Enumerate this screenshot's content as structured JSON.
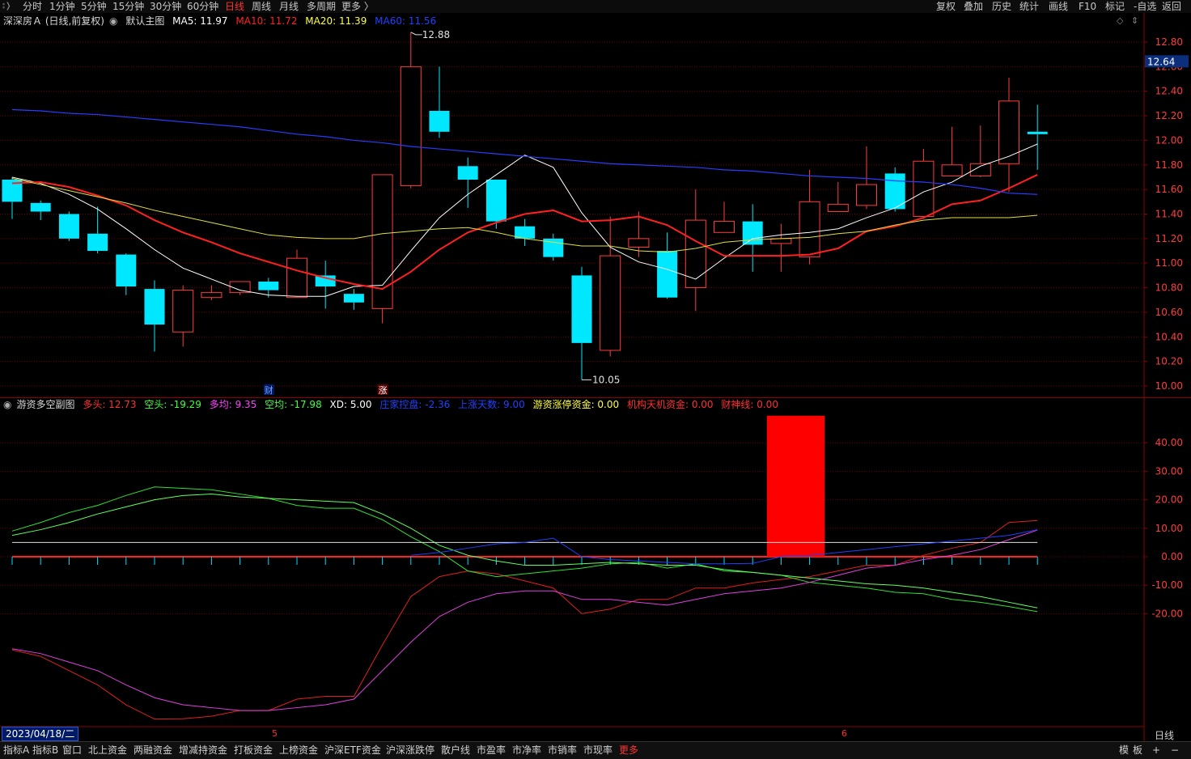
{
  "top_nav": {
    "left": [
      "分时",
      "1分钟",
      "5分钟",
      "15分钟",
      "30分钟",
      "60分钟",
      "日线",
      "周线",
      "月线",
      "多周期",
      "更多 〉"
    ],
    "active": "日线",
    "right": [
      "复权",
      "叠加",
      "历史",
      "统计",
      "画线",
      "F10",
      "标记",
      "-自选",
      "返回"
    ]
  },
  "main_legend": {
    "title": "深深房Ａ (日线,前复权)",
    "indicator_name": "默认主图",
    "items": [
      {
        "label": "MA5: 11.97",
        "color": "#ffffff"
      },
      {
        "label": "MA10: 11.72",
        "color": "#ff2020"
      },
      {
        "label": "MA20: 11.39",
        "color": "#ffff40"
      },
      {
        "label": "MA60: 11.56",
        "color": "#2040ff"
      }
    ]
  },
  "sub_legend": {
    "indicator_name": "游资多空副图",
    "items": [
      {
        "label": "多头: 12.73",
        "color": "#ff3030"
      },
      {
        "label": "空头: -19.29",
        "color": "#40ff40"
      },
      {
        "label": "多均: 9.35",
        "color": "#ff40ff"
      },
      {
        "label": "空均: -17.98",
        "color": "#40ff40"
      },
      {
        "label": "XD: 5.00",
        "color": "#ffffff"
      },
      {
        "label": "庄家控盘: -2.36",
        "color": "#2040ff"
      },
      {
        "label": "上涨天数: 9.00",
        "color": "#2040ff"
      },
      {
        "label": "游资涨停资金: 0.00",
        "color": "#ffff40"
      },
      {
        "label": "机构天机资金: 0.00",
        "color": "#ff3030"
      },
      {
        "label": "财神线: 0.00",
        "color": "#ff3030"
      }
    ]
  },
  "price_axis": {
    "ticks": [
      "12.80",
      "12.60",
      "12.40",
      "12.20",
      "12.00",
      "11.80",
      "11.60",
      "11.40",
      "11.20",
      "11.00",
      "10.80",
      "10.60",
      "10.40",
      "10.20",
      "10.00"
    ],
    "current_price": "12.64"
  },
  "annotations": {
    "high": "12.88",
    "low": "10.05",
    "marker_cai": "财",
    "marker_zhang": "涨"
  },
  "sub_axis": {
    "ticks": [
      "40.00",
      "30.00",
      "20.00",
      "10.00",
      "0.00",
      "-10.00",
      "-20.00"
    ]
  },
  "colors": {
    "up": "#ff3c3c",
    "down": "#00e8ff",
    "grid": "#6b0000"
  },
  "chart_data": [
    {
      "type": "candlestick",
      "title": "深深房Ａ (日线,前复权)",
      "ylim": [
        10.0,
        12.9
      ],
      "candles": [
        {
          "o": 11.68,
          "c": 11.5,
          "h": 11.7,
          "l": 11.36
        },
        {
          "o": 11.49,
          "c": 11.42,
          "h": 11.51,
          "l": 11.35
        },
        {
          "o": 11.4,
          "c": 11.2,
          "h": 11.42,
          "l": 11.18
        },
        {
          "o": 11.24,
          "c": 11.1,
          "h": 11.46,
          "l": 11.08
        },
        {
          "o": 11.07,
          "c": 10.81,
          "h": 11.08,
          "l": 10.74
        },
        {
          "o": 10.79,
          "c": 10.5,
          "h": 10.86,
          "l": 10.28
        },
        {
          "o": 10.44,
          "c": 10.78,
          "h": 10.82,
          "l": 10.32
        },
        {
          "o": 10.72,
          "c": 10.76,
          "h": 10.82,
          "l": 10.7
        },
        {
          "o": 10.76,
          "c": 10.85,
          "h": 10.85,
          "l": 10.74
        },
        {
          "o": 10.85,
          "c": 10.78,
          "h": 10.88,
          "l": 10.72
        },
        {
          "o": 10.72,
          "c": 11.04,
          "h": 11.11,
          "l": 10.72
        },
        {
          "o": 10.9,
          "c": 10.81,
          "h": 11.02,
          "l": 10.63
        },
        {
          "o": 10.75,
          "c": 10.68,
          "h": 10.79,
          "l": 10.62
        },
        {
          "o": 10.63,
          "c": 11.72,
          "h": 11.72,
          "l": 10.51
        },
        {
          "o": 11.63,
          "c": 12.6,
          "h": 12.88,
          "l": 11.61
        },
        {
          "o": 12.24,
          "c": 12.07,
          "h": 12.6,
          "l": 12.02
        },
        {
          "o": 11.79,
          "c": 11.68,
          "h": 11.86,
          "l": 11.45
        },
        {
          "o": 11.68,
          "c": 11.34,
          "h": 11.67,
          "l": 11.28
        },
        {
          "o": 11.3,
          "c": 11.2,
          "h": 11.36,
          "l": 11.14
        },
        {
          "o": 11.2,
          "c": 11.05,
          "h": 11.24,
          "l": 11.02
        },
        {
          "o": 10.9,
          "c": 10.35,
          "h": 10.97,
          "l": 10.05
        },
        {
          "o": 10.29,
          "c": 11.06,
          "h": 11.38,
          "l": 10.24
        },
        {
          "o": 11.13,
          "c": 11.2,
          "h": 11.42,
          "l": 11.05
        },
        {
          "o": 11.1,
          "c": 10.72,
          "h": 11.25,
          "l": 10.71
        },
        {
          "o": 10.8,
          "c": 11.35,
          "h": 11.6,
          "l": 10.61
        },
        {
          "o": 11.25,
          "c": 11.34,
          "h": 11.5,
          "l": 11.25
        },
        {
          "o": 11.34,
          "c": 11.15,
          "h": 11.48,
          "l": 10.93
        },
        {
          "o": 11.16,
          "c": 11.2,
          "h": 11.32,
          "l": 10.93
        },
        {
          "o": 11.05,
          "c": 11.5,
          "h": 11.76,
          "l": 10.99
        },
        {
          "o": 11.42,
          "c": 11.48,
          "h": 11.66,
          "l": 11.42
        },
        {
          "o": 11.47,
          "c": 11.64,
          "h": 11.95,
          "l": 11.44
        },
        {
          "o": 11.73,
          "c": 11.44,
          "h": 11.78,
          "l": 11.42
        },
        {
          "o": 11.38,
          "c": 11.83,
          "h": 11.93,
          "l": 11.36
        },
        {
          "o": 11.71,
          "c": 11.8,
          "h": 12.11,
          "l": 11.71
        },
        {
          "o": 11.71,
          "c": 11.81,
          "h": 12.12,
          "l": 11.7
        },
        {
          "o": 11.81,
          "c": 12.32,
          "h": 12.51,
          "l": 11.58
        },
        {
          "o": 12.07,
          "c": 12.05,
          "h": 12.29,
          "l": 11.76
        }
      ],
      "series": [
        {
          "name": "MA5",
          "values": [
            11.7,
            11.65,
            11.56,
            11.44,
            11.28,
            11.11,
            10.96,
            10.87,
            10.78,
            10.74,
            10.73,
            10.73,
            10.81,
            10.82,
            11.1,
            11.37,
            11.56,
            11.72,
            11.88,
            11.78,
            11.41,
            11.13,
            11.01,
            10.95,
            10.87,
            11.04,
            11.2,
            11.23,
            11.25,
            11.28,
            11.37,
            11.45,
            11.58,
            11.66,
            11.79,
            11.87,
            11.97
          ]
        },
        {
          "name": "MA10",
          "values": [
            11.65,
            11.66,
            11.62,
            11.55,
            11.47,
            11.35,
            11.25,
            11.17,
            11.08,
            11.01,
            10.94,
            10.88,
            10.83,
            10.79,
            10.93,
            11.11,
            11.25,
            11.33,
            11.4,
            11.43,
            11.34,
            11.35,
            11.38,
            11.31,
            11.18,
            11.06,
            11.06,
            11.06,
            11.07,
            11.12,
            11.26,
            11.3,
            11.37,
            11.48,
            11.51,
            11.61,
            11.72
          ]
        },
        {
          "name": "MA20",
          "values": [
            11.69,
            11.64,
            11.59,
            11.54,
            11.49,
            11.43,
            11.38,
            11.33,
            11.28,
            11.23,
            11.21,
            11.2,
            11.2,
            11.24,
            11.26,
            11.28,
            11.29,
            11.25,
            11.2,
            11.17,
            11.14,
            11.14,
            11.1,
            11.09,
            11.12,
            11.17,
            11.19,
            11.2,
            11.21,
            11.24,
            11.26,
            11.31,
            11.35,
            11.37,
            11.37,
            11.37,
            11.39
          ]
        },
        {
          "name": "MA60",
          "values": [
            12.25,
            12.24,
            12.22,
            12.21,
            12.19,
            12.17,
            12.15,
            12.13,
            12.11,
            12.08,
            12.05,
            12.03,
            12.0,
            11.98,
            11.95,
            11.93,
            11.91,
            11.89,
            11.87,
            11.85,
            11.83,
            11.81,
            11.8,
            11.79,
            11.78,
            11.76,
            11.75,
            11.73,
            11.71,
            11.7,
            11.69,
            11.67,
            11.66,
            11.64,
            11.61,
            11.57,
            11.56
          ]
        }
      ]
    },
    {
      "type": "line",
      "title": "游资多空副图",
      "ylim": [
        -55,
        50
      ],
      "series": [
        {
          "name": "多头",
          "values": [
            -32.7,
            -35,
            -40,
            -45,
            -52,
            -57,
            -56.9,
            -56,
            -54,
            -54,
            -50,
            -49,
            -49,
            -31,
            -14,
            -7,
            -5,
            -6,
            -8.5,
            -11,
            -20,
            -18.4,
            -15,
            -15,
            -11,
            -11,
            -9.2,
            -8,
            -7,
            -5,
            -3,
            -3,
            0.5,
            3,
            5,
            12,
            12.73
          ]
        },
        {
          "name": "空头",
          "values": [
            9,
            12,
            15.5,
            18,
            21.5,
            24.5,
            24,
            23.5,
            22,
            20.5,
            18,
            17,
            17,
            13,
            7,
            1.8,
            -5,
            -7,
            -6,
            -5,
            -4,
            -2.5,
            -2,
            -4,
            -2.5,
            -5,
            -5.5,
            -6.5,
            -9,
            -10,
            -11,
            -12.5,
            -13,
            -15,
            -16,
            -17.5,
            -19.29
          ]
        },
        {
          "name": "多均",
          "values": [
            -32.3,
            -34,
            -37,
            -40,
            -45,
            -49.5,
            -52,
            -53,
            -54,
            -54,
            -53,
            -52,
            -50,
            -40,
            -30,
            -21,
            -16,
            -13,
            -12,
            -12,
            -15,
            -15,
            -16,
            -17,
            -15,
            -13,
            -12,
            -11,
            -9,
            -6.5,
            -4,
            -3,
            -1,
            0.5,
            2.5,
            6,
            9.35
          ]
        },
        {
          "name": "空均",
          "values": [
            7.5,
            9.5,
            12,
            15,
            17.5,
            20,
            21.5,
            22,
            21,
            20.5,
            20,
            19.5,
            19,
            15,
            10,
            4,
            0.5,
            -1.5,
            -3,
            -3,
            -2.5,
            -2,
            -2.5,
            -3,
            -3,
            -4.5,
            -5.5,
            -6.5,
            -7.5,
            -8.5,
            -9.5,
            -10,
            -11,
            -12.5,
            -14,
            -16,
            -17.98
          ]
        },
        {
          "name": "XD",
          "values": [
            5,
            5,
            5,
            5,
            5,
            5,
            5,
            5,
            5,
            5,
            5,
            5,
            5,
            5,
            5,
            5,
            5,
            5,
            5,
            5,
            5,
            5,
            5,
            5,
            5,
            5,
            5,
            5,
            5,
            5,
            5,
            5,
            5,
            5,
            5,
            5,
            5
          ]
        },
        {
          "name": "庄家控盘",
          "values": [
            null,
            null,
            null,
            null,
            null,
            null,
            null,
            null,
            null,
            null,
            null,
            null,
            null,
            null,
            0.5,
            1.5,
            3,
            4.5,
            5,
            6.5,
            0,
            -1,
            -1.5,
            -2,
            -2.5,
            -2.5,
            -2.36,
            0,
            0.5,
            1.5,
            2.5,
            3.5,
            4.5,
            5.5,
            6.5,
            7.5,
            9.5
          ]
        },
        {
          "name": "游资涨停资金",
          "bar_values": [
            0,
            0,
            0,
            0,
            0,
            0,
            0,
            0,
            0,
            0,
            0,
            0,
            0,
            0,
            0,
            0,
            0,
            0,
            0,
            0,
            0,
            0,
            0,
            0,
            0,
            0,
            0,
            0,
            0,
            0,
            0,
            0,
            0,
            0,
            0,
            0,
            0
          ]
        },
        {
          "name": "机构天机资金",
          "values": [
            0
          ]
        },
        {
          "name": "财神线",
          "bar_values": [
            0,
            0,
            0,
            0,
            0,
            0,
            0,
            0,
            0,
            0,
            0,
            0,
            0,
            0,
            0,
            0,
            0,
            0,
            0,
            0,
            0,
            0,
            0,
            0,
            0,
            0,
            0,
            49.5,
            49.5,
            0,
            0,
            0,
            0,
            0,
            0,
            0,
            0
          ]
        }
      ]
    }
  ],
  "x_axis": {
    "labels": [
      "5",
      "6"
    ],
    "date": "2023/04/18/二"
  },
  "bottom_tabs": [
    "指标A",
    "指标B",
    "窗口",
    "北上资金",
    "两融资金",
    "增减持资金",
    "打板资金",
    "上榜资金",
    "沪深ETF资金",
    "沪深涨跌停",
    "散户线",
    "市盈率",
    "市净率",
    "市销率",
    "市现率",
    "更多"
  ],
  "bottom_right": [
    "模",
    "板",
    "+",
    "−",
    "日线"
  ]
}
